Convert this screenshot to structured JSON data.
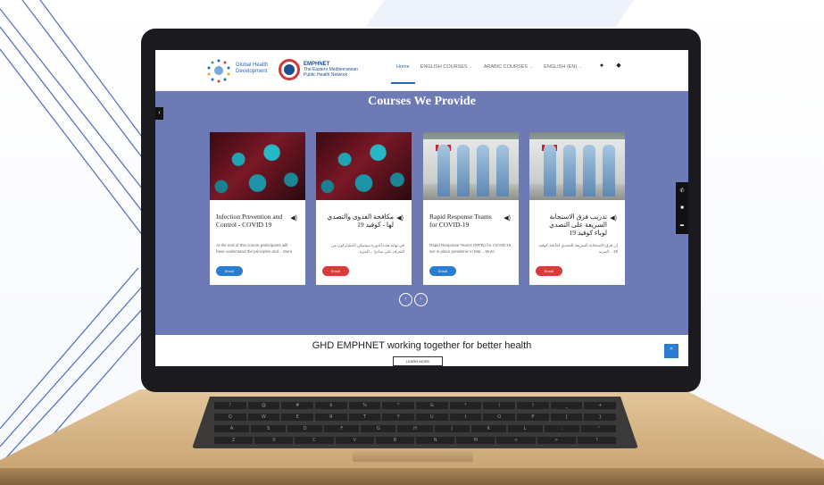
{
  "site": {
    "logo1_text": [
      "Global Health",
      "Development"
    ],
    "logo2_title": "EMPHNET",
    "logo2_sub": [
      "The Eastern Mediterranean",
      "Public Health Network"
    ]
  },
  "nav": {
    "items": [
      {
        "label": "Home",
        "active": true,
        "caret": false
      },
      {
        "label": "ENGLISH COURSES",
        "active": false,
        "caret": true
      },
      {
        "label": "ARABIC COURSES",
        "active": false,
        "caret": true
      },
      {
        "label": "ENGLISH (EN)",
        "active": false,
        "caret": true
      }
    ],
    "icons": [
      "user-icon",
      "chat-icon"
    ]
  },
  "hero": {
    "title": "Courses We Provide"
  },
  "courses": [
    {
      "title": "Infection Prevention and Control - COVID 19",
      "description": "At the end of this course participants will: - have understand the principles and... More",
      "button": "Enroll",
      "button_color": "#2a7ed0",
      "image": "virus",
      "rtl": false
    },
    {
      "title": "مكافحة العدوى والتصدي لها - كوفيد 19",
      "description": "في نهاية هذه الدورة سيتمكن المشاركون من: التعرف على مبادئ... المزيد",
      "button": "Enroll",
      "button_color": "#d93a3a",
      "image": "virus",
      "rtl": true
    },
    {
      "title": "Rapid Response Teams for COVID-19",
      "description": "Rapid Response Teams (RRTs) for COVID-19 are in place pandemic in Mar... More",
      "button": "Enroll",
      "button_color": "#2a7ed0",
      "image": "ambulance",
      "rtl": false
    },
    {
      "title": "تدريب فرق الاستجابة السريعة على التصدي لوباء كوفيد 19",
      "description": "إن فرق الاستجابة السريعة للتصدي لجائحة كوفيد 19... المزيد",
      "button": "Enroll",
      "button_color": "#d93a3a",
      "image": "ambulance",
      "rtl": true
    }
  ],
  "pager": {
    "prev": "‹",
    "next": "›"
  },
  "footer": {
    "title": "GHD EMPHNET working together for better health",
    "button": "LEARN MORE",
    "scroll_top": "^"
  },
  "side_icons": [
    "phone-icon",
    "mail-icon",
    "share-icon"
  ],
  "colors": {
    "hero_bg": "#6d7ab5",
    "brand_blue": "#2a69b8",
    "laptop_gold": "#d3b182",
    "bezel": "#1b1b1f"
  },
  "keyboard": {
    "row1": [
      "!",
      "@",
      "#",
      "$",
      "%",
      "^",
      "&",
      "*",
      "(",
      ")",
      "_",
      "+"
    ],
    "row2": [
      "Q",
      "W",
      "E",
      "R",
      "T",
      "Y",
      "U",
      "I",
      "O",
      "P",
      "{",
      "}"
    ],
    "row3": [
      "A",
      "S",
      "D",
      "F",
      "G",
      "H",
      "J",
      "K",
      "L",
      ":",
      "\""
    ],
    "row4": [
      "Z",
      "X",
      "C",
      "V",
      "B",
      "N",
      "M",
      "<",
      ">",
      "?"
    ]
  }
}
